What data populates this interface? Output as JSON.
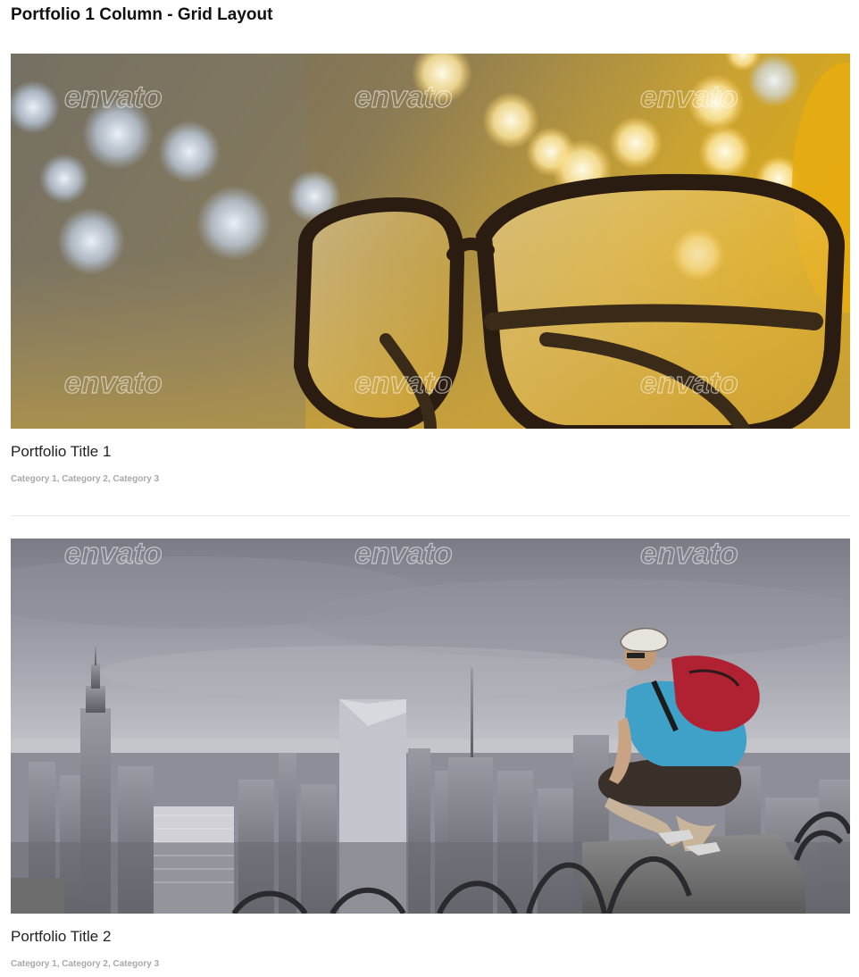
{
  "page": {
    "title": "Portfolio 1 Column - Grid Layout"
  },
  "items": [
    {
      "title": "Portfolio Title 1",
      "categories": [
        "Category 1",
        "Category 2",
        "Category 3"
      ],
      "separator": ", ",
      "watermark": "envato"
    },
    {
      "title": "Portfolio Title 2",
      "categories": [
        "Category 1",
        "Category 2",
        "Category 3"
      ],
      "separator": ", ",
      "watermark": "envato"
    }
  ]
}
